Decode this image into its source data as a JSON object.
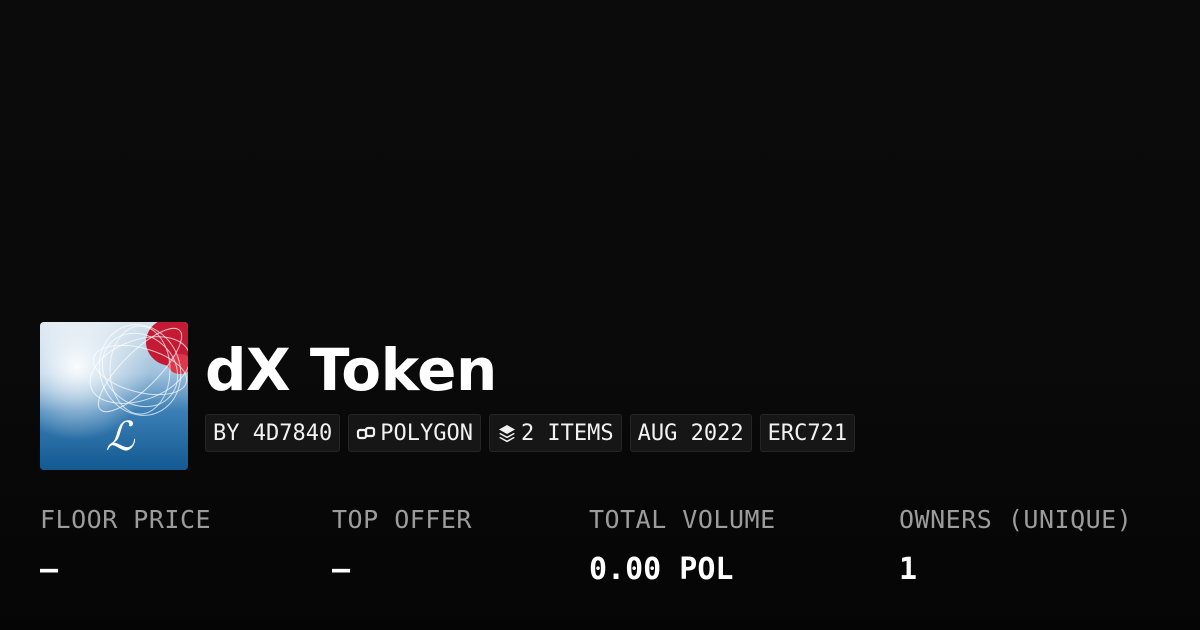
{
  "collection": {
    "title": "dX Token",
    "avatar": {
      "icon": "collection-avatar-image",
      "monogram": "ℒ"
    }
  },
  "badges": {
    "creator": "BY 4D7840",
    "chain": {
      "label": "POLYGON",
      "icon": "chain-link-icon"
    },
    "items": {
      "label": "2 ITEMS",
      "icon": "layers-icon"
    },
    "date": "AUG 2022",
    "standard": "ERC721"
  },
  "stats": {
    "floor_price": {
      "label": "FLOOR PRICE",
      "value": "–"
    },
    "top_offer": {
      "label": "TOP OFFER",
      "value": "–"
    },
    "total_volume": {
      "label": "TOTAL VOLUME",
      "value": "0.00 POL"
    },
    "owners": {
      "label": "OWNERS (UNIQUE)",
      "value": "1"
    }
  },
  "colors": {
    "background": "#0a0a0a",
    "badge_bg": "#161616",
    "label_gray": "#9c9c9c",
    "text": "#ffffff"
  }
}
